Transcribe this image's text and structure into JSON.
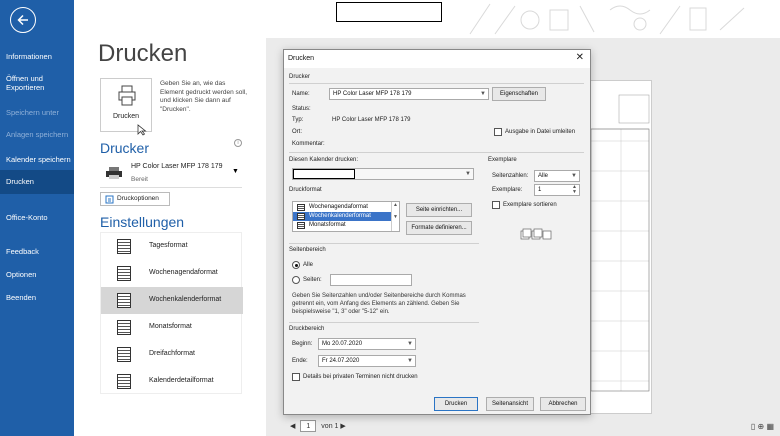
{
  "sidebar": {
    "items": [
      {
        "label": "Informationen",
        "state": "normal"
      },
      {
        "label": "Öffnen und Exportieren",
        "state": "normal"
      },
      {
        "label": "Speichern unter",
        "state": "disabled"
      },
      {
        "label": "Anlagen speichern",
        "state": "disabled"
      },
      {
        "label": "Kalender speichern",
        "state": "normal"
      },
      {
        "label": "Drucken",
        "state": "active"
      },
      {
        "label": "Office-Konto",
        "state": "normal"
      },
      {
        "label": "Feedback",
        "state": "normal"
      },
      {
        "label": "Optionen",
        "state": "normal"
      },
      {
        "label": "Beenden",
        "state": "normal"
      }
    ]
  },
  "main": {
    "heading": "Drucken",
    "print_button_label": "Drucken",
    "print_description": "Geben Sie an, wie das Element gedruckt werden soll, und klicken Sie dann auf \"Drucken\".",
    "printer_section": "Drucker",
    "printer_name": "HP Color Laser MFP 178 179",
    "printer_status": "Bereit",
    "printer_options": "Druckoptionen",
    "settings_section": "Einstellungen",
    "styles": [
      {
        "label": "Tagesformat",
        "selected": false
      },
      {
        "label": "Wochenagendaformat",
        "selected": false
      },
      {
        "label": "Wochenkalenderformat",
        "selected": true
      },
      {
        "label": "Monatsformat",
        "selected": false
      },
      {
        "label": "Dreifachformat",
        "selected": false
      },
      {
        "label": "Kalenderdetailformat",
        "selected": false
      }
    ]
  },
  "preview": {
    "page_current": "1",
    "page_of": "von 1"
  },
  "dialog": {
    "title": "Drucken",
    "group_printer": "Drucker",
    "name_label": "Name:",
    "name_value": "HP Color Laser MFP 178 179",
    "properties_button": "Eigenschaften",
    "status_label": "Status:",
    "type_label": "Typ:",
    "type_value": "HP Color Laser MFP 178 179",
    "location_label": "Ort:",
    "comment_label": "Kommentar:",
    "print_to_file": "Ausgabe in Datei umleiten",
    "calendar_label": "Diesen Kalender drucken:",
    "format_label": "Druckformat",
    "formats": [
      "Wochenagendaformat",
      "Wochenkalenderformat",
      "Monatsformat"
    ],
    "page_setup_button": "Seite einrichten...",
    "define_styles_button": "Formate definieren...",
    "copies_group": "Exemplare",
    "page_count_label": "Seitenzahlen:",
    "page_count_value": "Alle",
    "copies_label": "Exemplare:",
    "copies_value": "1",
    "collate_label": "Exemplare sortieren",
    "page_range_group": "Seitenbereich",
    "all_label": "Alle",
    "pages_label": "Seiten:",
    "page_range_hint": "Geben Sie Seitenzahlen und/oder Seitenbereiche durch Kommas getrennt ein, vom Anfang des Elements an zählend. Geben Sie beispielsweise \"1, 3\" oder \"5-12\" ein.",
    "print_range_group": "Druckbereich",
    "start_label": "Beginn:",
    "start_value": "Mo 20.07.2020",
    "end_label": "Ende:",
    "end_value": "Fr 24.07.2020",
    "hide_private": "Details bei privaten Terminen nicht drucken",
    "print_button": "Drucken",
    "preview_button": "Seitenansicht",
    "cancel_button": "Abbrechen"
  }
}
